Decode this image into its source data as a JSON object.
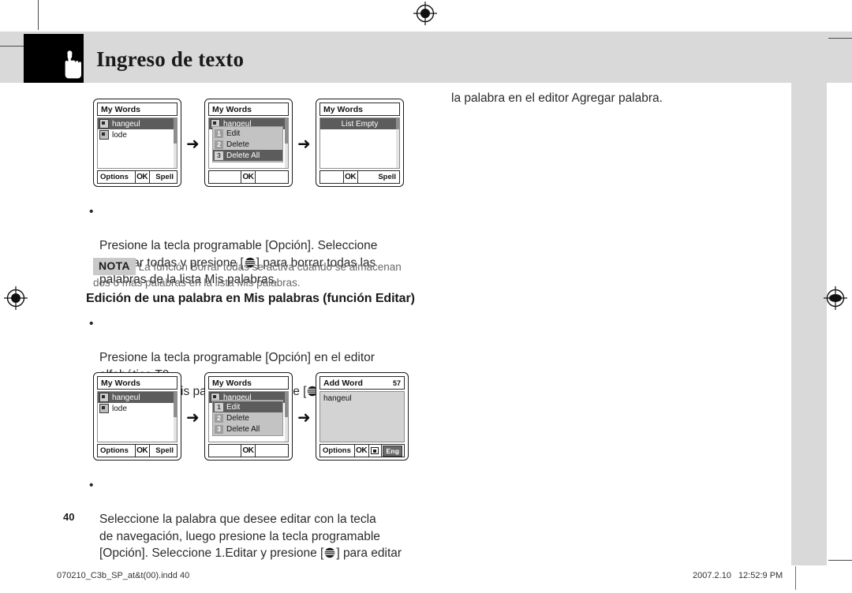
{
  "document": {
    "header_title": "Ingreso de texto",
    "page_number": "40",
    "footer_left": "070210_C3b_SP_at&t(00).indd   40",
    "footer_date": "2007.2.10",
    "footer_time": "12:52:9 PM"
  },
  "text": {
    "top_right": "la palabra en el editor Agregar palabra.",
    "para1_line1": "Presione la tecla programable [Opción]. Seleccione",
    "para1_line2_a": "3.Borrar todas y presione [",
    "para1_line2_b": "] para borrar todas las",
    "para1_line3": "palabras de la lista Mis palabras.",
    "note_badge": "NOTA",
    "note_line1": "La función Borrar todas se activa cuando se almacenan",
    "note_line2": "dos o más palabras en la lista Mis palabras.",
    "section_heading": "Edición de una palabra en Mis palabras (función Editar)",
    "para2_line1": "Presione la tecla programable [Opción] en el editor",
    "para2_line2": "alfabético T9.",
    "para2_line3_a": "Seleccione Mis palabras y presione [",
    "para2_line3_b": "].",
    "para3_line1": "Seleccione la palabra que desee editar con la tecla",
    "para3_line2": "de navegación, luego presione la tecla programable",
    "para3_line3_a": "[Opción]. Seleccione 1.Editar y presione [",
    "para3_line3_b": "] para editar"
  },
  "screens": {
    "row1": [
      {
        "id": "my-words-list",
        "title": "My Words",
        "list": [
          {
            "label": "hangeul",
            "selected": true
          },
          {
            "label": "lode",
            "selected": false
          }
        ],
        "softkeys": {
          "left": "Options",
          "middle": "OK",
          "right": "Spell"
        }
      },
      {
        "id": "my-words-options-delete-all",
        "title": "My Words",
        "list": [
          {
            "label": "hangeul",
            "selected": true
          }
        ],
        "menu": [
          {
            "num": "1",
            "label": "Edit",
            "selected": false
          },
          {
            "num": "2",
            "label": "Delete",
            "selected": false
          },
          {
            "num": "3",
            "label": "Delete All",
            "selected": true
          }
        ],
        "softkeys": {
          "left": "",
          "middle": "OK",
          "right": ""
        }
      },
      {
        "id": "my-words-empty",
        "title": "My Words",
        "empty_label": "List Empty",
        "softkeys": {
          "left": "",
          "middle": "OK",
          "right": "Spell"
        }
      }
    ],
    "row2": [
      {
        "id": "my-words-list-2",
        "title": "My Words",
        "list": [
          {
            "label": "hangeul",
            "selected": true
          },
          {
            "label": "lode",
            "selected": false
          }
        ],
        "softkeys": {
          "left": "Options",
          "middle": "OK",
          "right": "Spell"
        }
      },
      {
        "id": "my-words-options-edit",
        "title": "My Words",
        "list": [
          {
            "label": "hangeul",
            "selected": true
          }
        ],
        "menu": [
          {
            "num": "1",
            "label": "Edit",
            "selected": true
          },
          {
            "num": "2",
            "label": "Delete",
            "selected": false
          },
          {
            "num": "3",
            "label": "Delete All",
            "selected": false
          }
        ],
        "softkeys": {
          "left": "",
          "middle": "OK",
          "right": ""
        }
      },
      {
        "id": "add-word-editor",
        "title": "Add Word",
        "count": "57",
        "editor_value": "hangeul",
        "softkeys": {
          "left": "Options",
          "middle": "OK",
          "mode": "Eng"
        }
      }
    ]
  },
  "colors": {
    "banner": "#d9d9d9",
    "header_block": "#000000",
    "selection": "#5c5c5c",
    "menu_bg": "#c3c3c3",
    "note_badge": "#c9c9c9"
  }
}
